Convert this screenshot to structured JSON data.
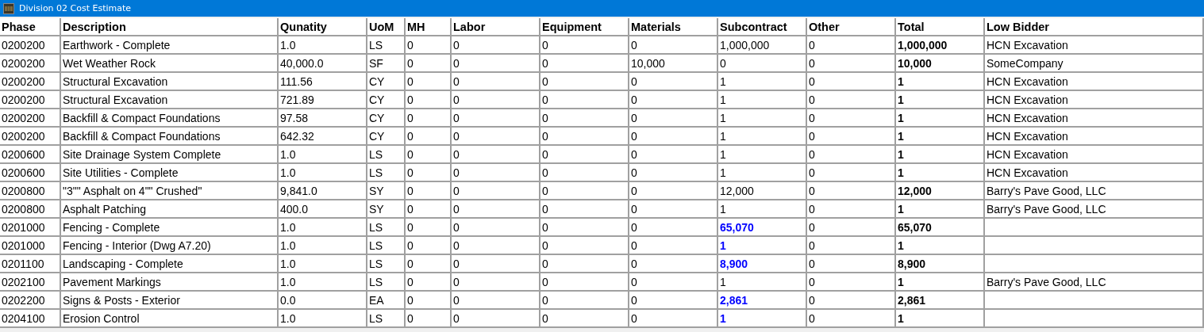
{
  "window": {
    "title": "Division 02 Cost Estimate"
  },
  "table": {
    "columns": [
      "Phase",
      "Description",
      "Qunatity",
      "UoM",
      "MH",
      "Labor",
      "Equipment",
      "Materials",
      "Subcontract",
      "Other",
      "Total",
      "Low Bidder"
    ],
    "rows": [
      {
        "phase": "0200200",
        "description": "Earthwork - Complete",
        "quantity": "1.0",
        "uom": "LS",
        "mh": "0",
        "labor": "0",
        "equipment": "0",
        "materials": "0",
        "subcontract": "1,000,000",
        "subcontract_highlighted": false,
        "other": "0",
        "total": "1,000,000",
        "low_bidder": "HCN Excavation"
      },
      {
        "phase": "0200200",
        "description": "Wet Weather Rock",
        "quantity": "40,000.0",
        "uom": "SF",
        "mh": "0",
        "labor": "0",
        "equipment": "0",
        "materials": "10,000",
        "subcontract": "0",
        "subcontract_highlighted": false,
        "other": "0",
        "total": "10,000",
        "low_bidder": "SomeCompany"
      },
      {
        "phase": "0200200",
        "description": "Structural Excavation",
        "quantity": "111.56",
        "uom": "CY",
        "mh": "0",
        "labor": "0",
        "equipment": "0",
        "materials": "0",
        "subcontract": "1",
        "subcontract_highlighted": false,
        "other": "0",
        "total": "1",
        "low_bidder": "HCN Excavation"
      },
      {
        "phase": "0200200",
        "description": "Structural Excavation",
        "quantity": "721.89",
        "uom": "CY",
        "mh": "0",
        "labor": "0",
        "equipment": "0",
        "materials": "0",
        "subcontract": "1",
        "subcontract_highlighted": false,
        "other": "0",
        "total": "1",
        "low_bidder": "HCN Excavation"
      },
      {
        "phase": "0200200",
        "description": "Backfill & Compact Foundations",
        "quantity": "97.58",
        "uom": "CY",
        "mh": "0",
        "labor": "0",
        "equipment": "0",
        "materials": "0",
        "subcontract": "1",
        "subcontract_highlighted": false,
        "other": "0",
        "total": "1",
        "low_bidder": "HCN Excavation"
      },
      {
        "phase": "0200200",
        "description": "Backfill & Compact Foundations",
        "quantity": "642.32",
        "uom": "CY",
        "mh": "0",
        "labor": "0",
        "equipment": "0",
        "materials": "0",
        "subcontract": "1",
        "subcontract_highlighted": false,
        "other": "0",
        "total": "1",
        "low_bidder": "HCN Excavation"
      },
      {
        "phase": "0200600",
        "description": "Site Drainage System Complete",
        "quantity": "1.0",
        "uom": "LS",
        "mh": "0",
        "labor": "0",
        "equipment": "0",
        "materials": "0",
        "subcontract": "1",
        "subcontract_highlighted": false,
        "other": "0",
        "total": "1",
        "low_bidder": "HCN Excavation"
      },
      {
        "phase": "0200600",
        "description": "Site Utilities - Complete",
        "quantity": "1.0",
        "uom": "LS",
        "mh": "0",
        "labor": "0",
        "equipment": "0",
        "materials": "0",
        "subcontract": "1",
        "subcontract_highlighted": false,
        "other": "0",
        "total": "1",
        "low_bidder": "HCN Excavation"
      },
      {
        "phase": "0200800",
        "description": "\"3\"\" Asphalt on 4\"\" Crushed\"",
        "quantity": "9,841.0",
        "uom": "SY",
        "mh": "0",
        "labor": "0",
        "equipment": "0",
        "materials": "0",
        "subcontract": "12,000",
        "subcontract_highlighted": false,
        "other": "0",
        "total": "12,000",
        "low_bidder": "Barry's Pave Good, LLC"
      },
      {
        "phase": "0200800",
        "description": "Asphalt Patching",
        "quantity": "400.0",
        "uom": "SY",
        "mh": "0",
        "labor": "0",
        "equipment": "0",
        "materials": "0",
        "subcontract": "1",
        "subcontract_highlighted": false,
        "other": "0",
        "total": "1",
        "low_bidder": "Barry's Pave Good, LLC"
      },
      {
        "phase": "0201000",
        "description": "Fencing - Complete",
        "quantity": "1.0",
        "uom": "LS",
        "mh": "0",
        "labor": "0",
        "equipment": "0",
        "materials": "0",
        "subcontract": "65,070",
        "subcontract_highlighted": true,
        "other": "0",
        "total": "65,070"
      },
      {
        "phase": "0201000",
        "description": "Fencing - Interior (Dwg A7.20)",
        "quantity": "1.0",
        "uom": "LS",
        "mh": "0",
        "labor": "0",
        "equipment": "0",
        "materials": "0",
        "subcontract": "1",
        "subcontract_highlighted": true,
        "other": "0",
        "total": "1"
      },
      {
        "phase": "0201100",
        "description": "Landscaping - Complete",
        "quantity": "1.0",
        "uom": "LS",
        "mh": "0",
        "labor": "0",
        "equipment": "0",
        "materials": "0",
        "subcontract": "8,900",
        "subcontract_highlighted": true,
        "other": "0",
        "total": "8,900"
      },
      {
        "phase": "0202100",
        "description": "Pavement Markings",
        "quantity": "1.0",
        "uom": "LS",
        "mh": "0",
        "labor": "0",
        "equipment": "0",
        "materials": "0",
        "subcontract": "1",
        "subcontract_highlighted": false,
        "other": "0",
        "total": "1",
        "low_bidder": "Barry's Pave Good, LLC"
      },
      {
        "phase": "0202200",
        "description": "Signs & Posts - Exterior",
        "quantity": "0.0",
        "uom": "EA",
        "mh": "0",
        "labor": "0",
        "equipment": "0",
        "materials": "0",
        "subcontract": "2,861",
        "subcontract_highlighted": true,
        "other": "0",
        "total": "2,861"
      },
      {
        "phase": "0204100",
        "description": "Erosion Control",
        "quantity": "1.0",
        "uom": "LS",
        "mh": "0",
        "labor": "0",
        "equipment": "0",
        "materials": "0",
        "subcontract": "1",
        "subcontract_highlighted": true,
        "other": "0",
        "total": "1"
      }
    ]
  }
}
